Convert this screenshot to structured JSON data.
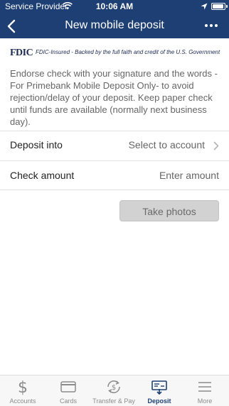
{
  "status_bar": {
    "carrier": "Service Provider",
    "time": "10:06 AM"
  },
  "header": {
    "title": "New mobile deposit",
    "back_icon": "chevron-left-icon",
    "more_icon": "more-dots-icon"
  },
  "fdic": {
    "logo": "FDIC",
    "text": "FDIC-Insured - Backed by the full faith and credit of the U.S. Government"
  },
  "notice": "Endorse check with your signature and the words -For Primebank Mobile Deposit Only- to avoid rejection/delay of your deposit. Keep paper check until funds are available (normally next business day).",
  "form": {
    "deposit_into": {
      "label": "Deposit into",
      "value": "Select to account"
    },
    "check_amount": {
      "label": "Check amount",
      "placeholder": "Enter amount"
    }
  },
  "take_photos_label": "Take photos",
  "tabs": [
    {
      "label": "Accounts",
      "icon": "dollar-icon"
    },
    {
      "label": "Cards",
      "icon": "card-icon"
    },
    {
      "label": "Transfer & Pay",
      "icon": "transfer-icon"
    },
    {
      "label": "Deposit",
      "icon": "check-deposit-icon",
      "active": true
    },
    {
      "label": "More",
      "icon": "menu-icon"
    }
  ],
  "colors": {
    "brand": "#1d3f73",
    "tab_inactive": "#8b8b8b",
    "button_disabled": "#d2d2d2"
  }
}
